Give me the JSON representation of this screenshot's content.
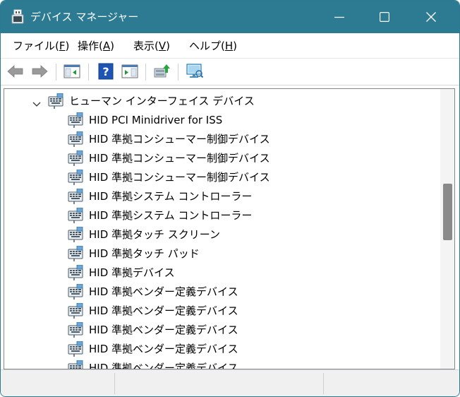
{
  "window": {
    "title": "デバイス マネージャー",
    "icon": "device-manager-icon"
  },
  "titlebar_buttons": [
    "minimize-icon",
    "maximize-icon",
    "close-icon"
  ],
  "menu": [
    {
      "pre": "ファイル(",
      "key": "F",
      "post": ")"
    },
    {
      "pre": "操作(",
      "key": "A",
      "post": ")"
    },
    {
      "pre": "表示(",
      "key": "V",
      "post": ")"
    },
    {
      "pre": "ヘルプ(",
      "key": "H",
      "post": ")"
    }
  ],
  "toolbar": {
    "icons": [
      "back-arrow-icon",
      "forward-arrow-icon",
      "show-hide-console-tree-icon",
      "help-icon",
      "properties-icon",
      "update-driver-icon",
      "scan-hardware-changes-icon"
    ]
  },
  "tree": {
    "category": {
      "label": "ヒューマン インターフェイス デバイス",
      "expanded": true,
      "icon": "hid-device-icon"
    },
    "items": [
      "HID PCI Minidriver for ISS",
      "HID 準拠コンシューマー制御デバイス",
      "HID 準拠コンシューマー制御デバイス",
      "HID 準拠コンシューマー制御デバイス",
      "HID 準拠システム コントローラー",
      "HID 準拠システム コントローラー",
      "HID 準拠タッチ スクリーン",
      "HID 準拠タッチ パッド",
      "HID 準拠デバイス",
      "HID 準拠ベンダー定義デバイス",
      "HID 準拠ベンダー定義デバイス",
      "HID 準拠ベンダー定義デバイス",
      "HID 準拠ベンダー定義デバイス",
      "HID 準拠ベンダー定義デバイス"
    ]
  },
  "colors": {
    "titlebar": "#2c7b93",
    "window_border": "#2b7a91",
    "scroll_thumb": "#8a8a8a"
  }
}
